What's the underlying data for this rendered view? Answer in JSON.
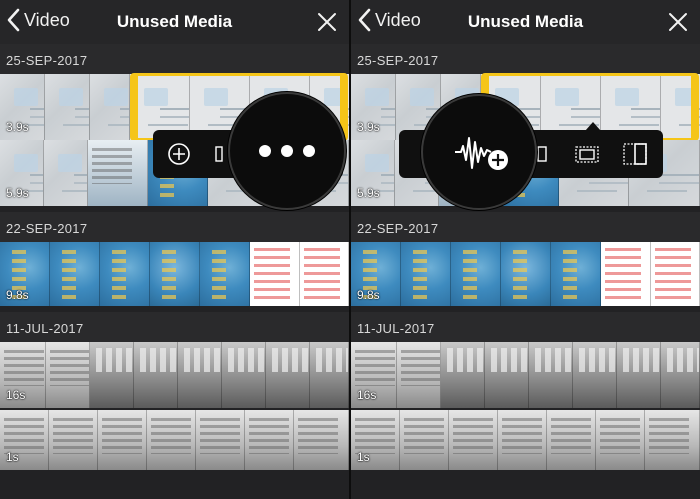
{
  "nav": {
    "back_label": "Video",
    "title": "Unused Media"
  },
  "sections": {
    "s1": {
      "date": "25-SEP-2017",
      "clip_a_duration": "3.9s",
      "clip_b_duration": "5.9s"
    },
    "s2": {
      "date": "22-SEP-2017",
      "clip_duration": "9.8s"
    },
    "s3": {
      "date": "11-JUL-2017",
      "clip_a_duration": "16s",
      "clip_b_duration": "1s"
    }
  },
  "left_toolbar": {
    "actions": [
      "add-icon",
      "split-icon",
      "more-icon"
    ]
  },
  "right_toolbar": {
    "actions": [
      "detach-audio-icon",
      "picture-in-picture-icon",
      "split-screen-icon"
    ]
  },
  "colors": {
    "selection": "#f5c518",
    "toolbar": "#101010",
    "header": "#2a2a2c"
  }
}
